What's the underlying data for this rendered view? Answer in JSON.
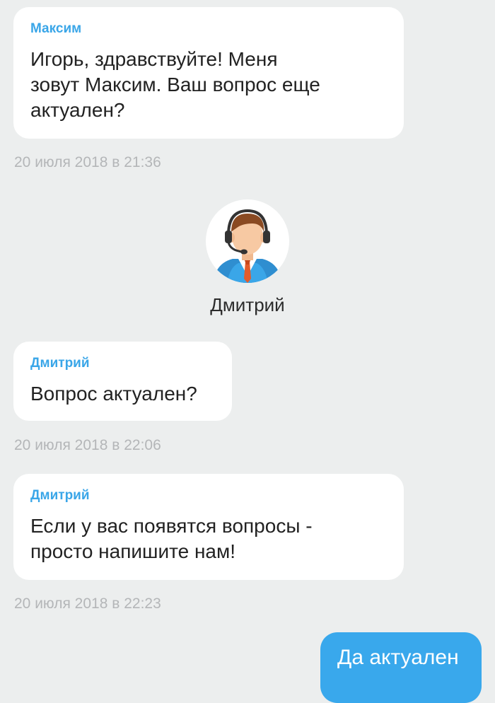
{
  "messages": [
    {
      "sender": "Максим",
      "text_lines": [
        "Игорь, здравствуйте! Меня",
        "зовут Максим. Ваш вопрос еще",
        "актуален?"
      ],
      "timestamp": "20 июля 2018 в 21:36"
    },
    {
      "sender": "Дмитрий",
      "text_lines": [
        "Вопрос актуален?"
      ],
      "timestamp": "20 июля 2018 в 22:06"
    },
    {
      "sender": "Дмитрий",
      "text_lines": [
        "Если у вас появятся вопросы -",
        "просто напишите нам!"
      ],
      "timestamp": "20 июля 2018 в 22:23"
    }
  ],
  "agent": {
    "name": "Дмитрий",
    "avatar_icon": "support-agent-headset-icon"
  },
  "outgoing": {
    "text": "Да актуален"
  },
  "colors": {
    "background": "#eceeee",
    "sender_name": "#3aa6e8",
    "outgoing_bubble": "#39a8ec",
    "timestamp": "#b4b6b8"
  }
}
